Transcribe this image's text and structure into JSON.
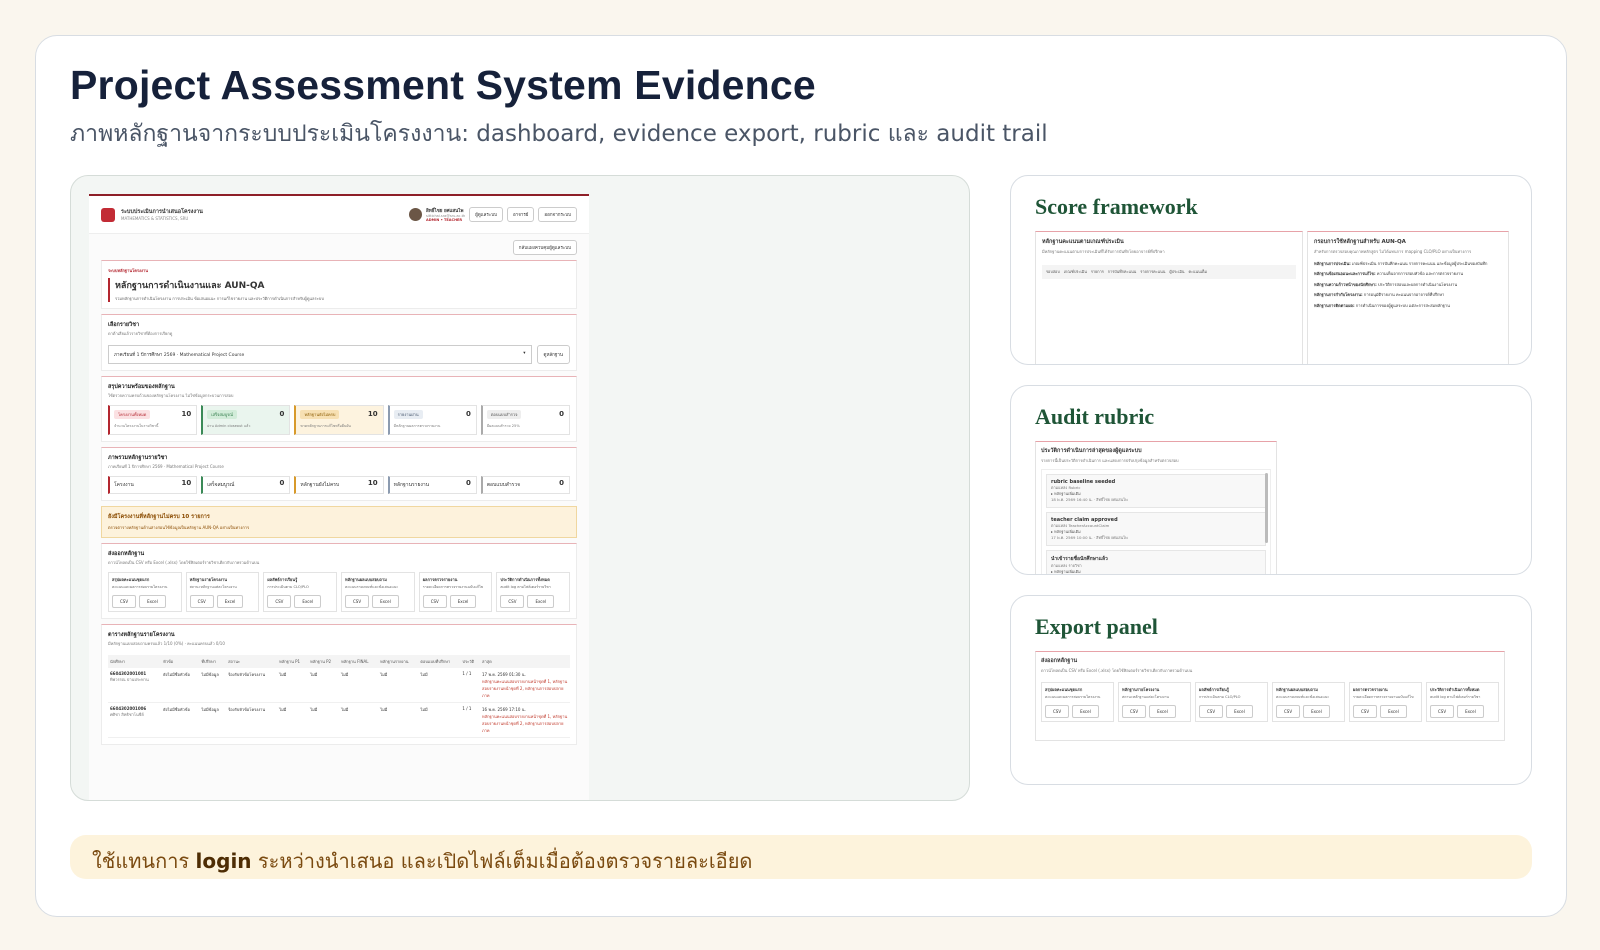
{
  "page": {
    "title": "Project Assessment System Evidence",
    "subtitle": "ภาพหลักฐานจากระบบประเมินโครงงาน: dashboard, evidence export, rubric และ audit trail",
    "caption_pre": "ใช้แทนการ ",
    "caption_bold": "login",
    "caption_post": " ระหว่างนำเสนอ และเปิดไฟล์เต็มเมื่อต้องตรวจรายละเอียด"
  },
  "screenshot": {
    "app_name": "ระบบประเมินการนำเสนอโครงงาน",
    "app_sub": "MATHEMATICS & STATISTICS, SRU",
    "user_name": "สิทธิ์ไชย ยศแสนไพ",
    "user_email": "sittichai.sra@sru.ac.th",
    "user_role": "ADMIN • TEACHER",
    "nav": [
      "ผู้ดูแลระบบ",
      "อาจารย์",
      "ออกจากระบบ"
    ],
    "back_button": "กลับแผงควบคุมผู้ดูแลระบบ",
    "header": {
      "crumb": "ระบบหลักฐานโครงงาน",
      "title": "หลักฐานการดำเนินงานและ AUN-QA",
      "desc": "รวมหลักฐานการดำเนินโครงงาน การประเมิน ข้อเสนอแนะ การแก้ไขรายงาน และประวัติการดำเนินการสำหรับผู้ดูแลระบบ"
    },
    "course": {
      "title": "เลือกรายวิชา",
      "desc": "ดาต้าเสียแล้วรายวิชาที่ต้องการเรียกดู",
      "selected": "ภาคเรียนที่ 1 ปีการศึกษา 2569 · Mathematical Project Course",
      "button": "ดูหลักฐาน"
    },
    "summary": {
      "title": "สรุปความพร้อมของหลักฐาน",
      "desc": "ใช้ตรวจความครบถ้วนของหลักฐานโครงงาน ไม่ใช่ข้อมูลกระบวนการสอบ",
      "stats": [
        {
          "label": "โครงงานทั้งหมด",
          "value": "10",
          "note": "จำนวนโครงงานในรายวิชานี้"
        },
        {
          "label": "เสร็จสมบูรณ์",
          "value": "0",
          "note": "ผ่าน Admin closeout แล้ว"
        },
        {
          "label": "หลักฐานยังไม่ครบ",
          "value": "10",
          "note": "ขาดหลักฐานการแก้ไขหรือยืนยัน"
        },
        {
          "label": "รายงานผ่าน",
          "value": "0",
          "note": "มีหลักฐานผลการตรวจรายงาน"
        },
        {
          "label": "ตอบแบบสำรวจ",
          "value": "0",
          "note": "มีผลแบบสำรวจ 25%"
        }
      ]
    },
    "overview": {
      "title": "ภาพรวมหลักฐานรายวิชา",
      "desc": "ภาคเรียนที่ 1 ปีการศึกษา 2569 · Mathematical Project Course",
      "items": [
        {
          "label": "โครงงาน",
          "value": "10"
        },
        {
          "label": "เสร็จสมบูรณ์",
          "value": "0"
        },
        {
          "label": "หลักฐานยังไม่ครบ",
          "value": "10"
        },
        {
          "label": "หลักฐานรายงาน",
          "value": "0"
        },
        {
          "label": "ตอบแบบสำรวจ",
          "value": "0"
        }
      ]
    },
    "warning": {
      "title": "ยังมีโครงงานที่หลักฐานไม่ครบ 10 รายการ",
      "desc": "ตรวจตารางหลักฐานด้านล่างก่อนใช้ข้อมูลเป็นหลักฐาน AUN-QA อย่างเป็นทางการ"
    },
    "exports": {
      "title": "ส่งออกหลักฐาน",
      "desc": "ดาวน์โหลดเป็น CSV หรือ Excel (.xlsx) โดยใช้ฟิลเตอร์รายวิชาเดียวกับภาพรวมด้านบน",
      "csv": "CSV",
      "excel": "Excel",
      "items": [
        {
          "title": "สรุปผลคะแนนชุดแรก",
          "desc": "คะแนนและผลการสอบรายโครงงาน"
        },
        {
          "title": "หลักฐานรายโครงงาน",
          "desc": "สถานะหลักฐานแต่ละโครงงาน"
        },
        {
          "title": "ผลลัพธ์การเรียนรู้",
          "desc": "การประเมินตาม CLO/PLO"
        },
        {
          "title": "หลักฐานผลแบบสอบถาม",
          "desc": "คะแนนรายเกณฑ์และข้อเสนอแนะ"
        },
        {
          "title": "ผลการตรวจรายงาน",
          "desc": "รายละเอียดการตรวจรายงานฉบับแก้ไข"
        },
        {
          "title": "ประวัติการดำเนินการทั้งหมด",
          "desc": "audit log ตามไฟล์เตอร์รายวิชา"
        }
      ]
    },
    "table": {
      "title": "ตารางหลักฐานรายโครงงาน",
      "desc": "มีหลักฐานแบบสอบถามครบแล้ว 1/10 (0%) · คะแนนครบแล้ว 0/10",
      "headers": [
        "นักศึกษา",
        "หัวข้อ",
        "ที่ปรึกษา",
        "สถานะ",
        "หลักฐาน P1",
        "หลักฐาน P2",
        "หลักฐาน FINAL",
        "หลักฐานรายงาน",
        "ตอบแบบที่ปรึกษา",
        "ประวัติ",
        "ล่าสุด"
      ],
      "rows": [
        {
          "id": "6604302001001",
          "name": "ทิพวรรณ ปานประทาน",
          "topic": "ยังไม่มีชื่อหัวข้อ",
          "advisor": "ไม่มีข้อมูล",
          "status": "ร้องรับหัวข้อโครงงาน",
          "p1": "ไม่มี",
          "p2": "ไม่มี",
          "final": "ไม่มี",
          "report": "ไม่มี",
          "survey": "ไม่มี",
          "history": "1 / 1",
          "latest": "17 พ.ค. 2569 01:30 น.",
          "note": "หลักฐานคะแนนสอบรายงานหน้าชุดที่ 1, หลักฐานสอบรายงานหน้าชุดที่ 2, หลักฐานการสอบปลายภาค"
        },
        {
          "id": "6604302001006",
          "name": "ศศิชา สิทธิชาโนชีย์",
          "topic": "ยังไม่มีชื่อหัวข้อ",
          "advisor": "ไม่มีข้อมูล",
          "status": "ร้องรับหัวข้อโครงงาน",
          "p1": "ไม่มี",
          "p2": "ไม่มี",
          "final": "ไม่มี",
          "report": "ไม่มี",
          "survey": "ไม่มี",
          "history": "1 / 1",
          "latest": "16 พ.ค. 2569 17:10 น.",
          "note": "หลักฐานคะแนนสอบรายงานหน้าชุดที่ 1, หลักฐานสอบรายงานหน้าชุดที่ 2, หลักฐานการสอบปลายภาค"
        }
      ]
    }
  },
  "panels": {
    "score": {
      "heading": "Score framework",
      "left_title": "หลักฐานคะแนนตามเกณฑ์ประเมิน",
      "left_desc": "มีหลักฐานคะแนนตามการประเมินที่ได้รับการบันทึกโดยอาจารย์ที่ปรึกษา",
      "left_cols": [
        "รอบสอบ",
        "เกณฑ์ประเมิน",
        "รายการ",
        "การบันทึกคะแนน",
        "รายการคะแนน",
        "ผู้ประเมิน",
        "คะแนนเต็ม"
      ],
      "right_title": "กรอบการใช้หลักฐานสำหรับ AUN-QA",
      "right_desc": "สำหรับการตรวจสอบคุณภาพหลักสูตร ไม่ได้แทนการ mapping CLO/PLO อย่างเป็นทางการ",
      "right_items": [
        {
          "k": "หลักฐานการประเมิน:",
          "v": "เกณฑ์ประเมิน การบันทึกคะแนน รายการคะแนน และข้อมูลผู้ประเมินของบันทึก"
        },
        {
          "k": "หลักฐานข้อเสนอแนะและการแก้ไข:",
          "v": "ความเห็นจากการสอบหัวข้อ และการตรวจรายงาน"
        },
        {
          "k": "หลักฐานความก้าวหน้าของนักศึกษา:",
          "v": "ประวัติการสอบและผลการดำเนินงานโครงงาน"
        },
        {
          "k": "หลักฐานการกำกับโครงงาน:",
          "v": "การอนุมัติรายงาน คะแนนจากอาจารย์ที่ปรึกษา"
        },
        {
          "k": "หลักฐานการติดตามผล:",
          "v": "การดำเนินการของผู้ดูแลระบบ แต่ละการสะสมหลักฐาน"
        }
      ]
    },
    "audit": {
      "heading": "Audit rubric",
      "title": "ประวัติการดำเนินการล่าสุดของผู้ดูแลระบบ",
      "desc": "รายการนี้เป็นประวัติการดำเนินการ และแสดงการปรับปรุงข้อมูลสำหรับตรวจสอบ",
      "items": [
        {
          "title": "rubric baseline seeded",
          "type": "ตามแหล่ง Rubric",
          "link": "▸ หลักฐานเพิ่มเติม",
          "time": "18 พ.ค. 2569 16:40 น. · สิทธิ์ไชย ยศแสนไพ"
        },
        {
          "title": "teacher claim approved",
          "type": "ตามแหล่ง TeacherAccountClaim",
          "link": "▸ หลักฐานเพิ่มเติม",
          "time": "17 พ.ค. 2569 10:00 น. · สิทธิ์ไชย ยศแสนไพ"
        },
        {
          "title": "นำเข้ารายชื่อนักศึกษาแล้ว",
          "type": "ตามแหล่ง รายวิชา",
          "link": "▸ หลักฐานเพิ่มเติม",
          "time": ""
        }
      ]
    },
    "export": {
      "heading": "Export panel"
    }
  }
}
